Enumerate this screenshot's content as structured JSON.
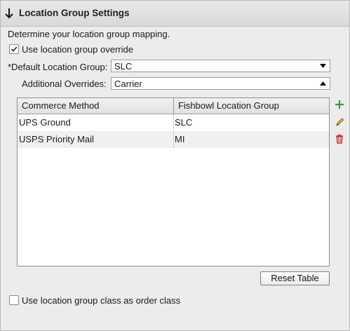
{
  "header": {
    "title": "Location Group Settings",
    "collapse_icon": "arrow-down-icon"
  },
  "description": "Determine your location group mapping.",
  "override_checkbox": {
    "label": "Use location group override",
    "checked": true
  },
  "default_location_group": {
    "label": "*Default Location Group:",
    "value": "SLC"
  },
  "additional_overrides": {
    "label": "Additional Overrides:",
    "value": "Carrier"
  },
  "table": {
    "columns": [
      "Commerce Method",
      "Fishbowl Location Group"
    ],
    "rows": [
      [
        "UPS Ground",
        "SLC"
      ],
      [
        "USPS Priority Mail",
        "MI"
      ]
    ]
  },
  "side_actions": {
    "add_icon": "plus-icon",
    "edit_icon": "pencil-icon",
    "delete_icon": "trash-icon",
    "add_color": "#3a9a3a",
    "edit_color": "#c8a024",
    "delete_color": "#d03030"
  },
  "reset_button": {
    "label": "Reset Table"
  },
  "class_checkbox": {
    "label": "Use location group class as order class",
    "checked": false
  }
}
